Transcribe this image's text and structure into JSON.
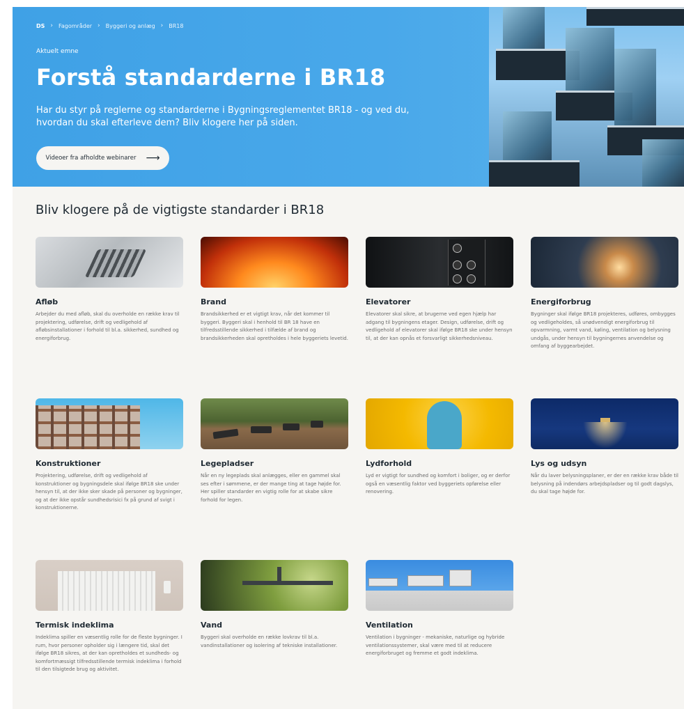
{
  "breadcrumb": {
    "logo": "DS",
    "items": [
      "Fagområder",
      "Byggeri og anlæg",
      "BR18"
    ]
  },
  "hero": {
    "eyebrow": "Aktuelt emne",
    "title": "Forstå standarderne i BR18",
    "lead": "Har du styr på reglerne og standarderne i Bygningsreglementet BR18 - og ved du, hvordan du skal efterleve dem? Bliv klogere her på siden.",
    "button_label": "Videoer fra afholdte webinarer",
    "button_icon": "arrow-right-icon"
  },
  "section": {
    "title": "Bliv klogere på de vigtigste standarder i BR18"
  },
  "cards": [
    {
      "title": "Afløb",
      "text": "Arbejder du med afløb, skal du overholde en række krav til projektering, udførelse, drift og vedligehold af afløbsinstallationer i forhold til bl.a. sikkerhed, sundhed og energiforbrug."
    },
    {
      "title": "Brand",
      "text": "Brandsikkerhed er et vigtigt krav, når det kommer til byggeri. Byggeri skal i henhold til BR 18 have en tilfredsstillende sikkerhed i tilfælde af brand og brandsikkerheden skal opretholdes i hele byggeriets levetid."
    },
    {
      "title": "Elevatorer",
      "text": "Elevatorer skal sikre, at brugerne ved egen hjælp har adgang til bygningens etager. Design, udførelse, drift og vedligehold af elevatorer skal ifølge BR18 ske under hensyn til, at der kan opnås et forsvarligt sikkerhedsniveau."
    },
    {
      "title": "Energiforbrug",
      "text": "Bygninger skal ifølge BR18 projekteres, udføres, ombygges og vedligeholdes, så unødvendigt energiforbrug til opvarmning, varmt vand, køling, ventilation og belysning undgås, under hensyn til bygningernes anvendelse og omfang af byggearbejdet."
    },
    {
      "title": "Konstruktioner",
      "text": "Projektering, udførelse, drift og vedligehold af konstruktioner og bygningsdele skal ifølge BR18 ske under hensyn til, at der ikke sker skade på personer og bygninger, og at der ikke opstår sundhedsrisici fx på grund af svigt i konstruktionerne."
    },
    {
      "title": "Legepladser",
      "text": "Når en ny legeplads skal anlægges, eller en gammel skal ses efter i sømmene, er der mange ting at tage højde for. Her spiller standarder en vigtig rolle for at skabe sikre forhold for legen."
    },
    {
      "title": "Lydforhold",
      "text": "Lyd er vigtigt for sundhed og komfort i boliger, og er derfor også en væsentlig faktor ved byggeriets opførelse eller renovering."
    },
    {
      "title": "Lys og udsyn",
      "text": "Når du laver belysningsplaner, er der en række krav både til belysning på indendørs arbejdspladser og til godt dagslys, du skal tage højde for."
    },
    {
      "title": "Termisk indeklima",
      "text": "Indeklima spiller en væsentlig rolle for de fleste bygninger. I rum, hvor personer opholder sig i længere tid, skal det ifølge BR18 sikres, at der kan opretholdes et sundheds- og komfortmæssigt tilfredsstillende termisk indeklima i forhold til den tilsigtede brug og aktivitet."
    },
    {
      "title": "Vand",
      "text": "Byggeri skal overholde en række lovkrav til bl.a. vandinstallationer og isolering af tekniske installationer."
    },
    {
      "title": "Ventilation",
      "text": "Ventilation i bygninger - mekaniske, naturlige og hybride ventilationssystemer, skal være med til at reducere energiforbruget og fremme et godt indeklima."
    }
  ],
  "colors": {
    "hero_blue": "#45a6e9",
    "page_bg": "#f6f5f2",
    "heading": "#1f2a33",
    "body_text": "#6a6a6a"
  }
}
